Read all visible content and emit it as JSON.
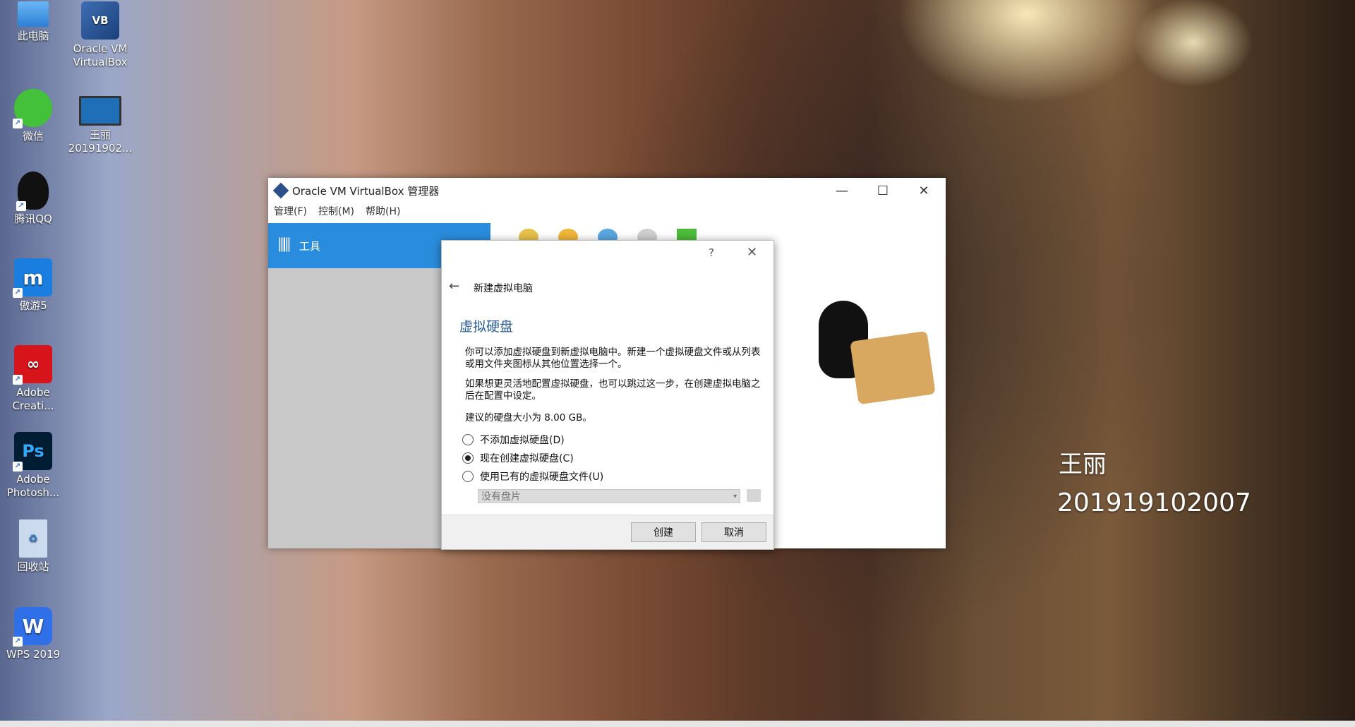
{
  "desktop": {
    "icons": [
      {
        "label": "此电脑",
        "icon": "computer-icon"
      },
      {
        "label": "Oracle VM VirtualBox",
        "icon": "virtualbox-icon"
      },
      {
        "label": "微信",
        "icon": "wechat-icon"
      },
      {
        "label": "王丽 20191902...",
        "icon": "video-file-icon"
      },
      {
        "label": "腾讯QQ",
        "icon": "qq-icon"
      },
      {
        "label": "傲游5",
        "icon": "maxthon-icon"
      },
      {
        "label": "Adobe Creati...",
        "icon": "adobe-cc-icon"
      },
      {
        "label": "Adobe Photosh...",
        "icon": "photoshop-icon"
      },
      {
        "label": "回收站",
        "icon": "recycle-bin-icon"
      },
      {
        "label": "WPS 2019",
        "icon": "wps-icon"
      }
    ],
    "overlay_name": "王丽",
    "overlay_id": "201919102007"
  },
  "main_window": {
    "title": "Oracle VM VirtualBox 管理器",
    "menu": [
      "管理(F)",
      "控制(M)",
      "帮助(H)"
    ],
    "tools_label": "工具"
  },
  "dialog": {
    "help": "?",
    "header": "新建虚拟电脑",
    "section_title": "虚拟硬盘",
    "para1": "你可以添加虚拟硬盘到新虚拟电脑中。新建一个虚拟硬盘文件或从列表或用文件夹图标从其他位置选择一个。",
    "para2": "如果想更灵活地配置虚拟硬盘，也可以跳过这一步，在创建虚拟电脑之后在配置中设定。",
    "recommend": "建议的硬盘大小为 8.00 GB。",
    "options": [
      {
        "label": "不添加虚拟硬盘(D)",
        "selected": false
      },
      {
        "label": "现在创建虚拟硬盘(C)",
        "selected": true
      },
      {
        "label": "使用已有的虚拟硬盘文件(U)",
        "selected": false
      }
    ],
    "disk_select": "没有盘片",
    "create_button": "创建",
    "cancel_button": "取消"
  }
}
